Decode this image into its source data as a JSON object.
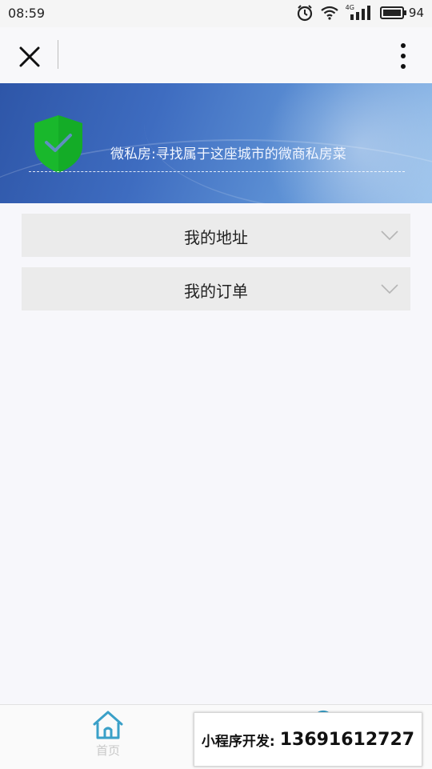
{
  "status_bar": {
    "time": "08:59",
    "network_type": "4G",
    "battery_level": "94",
    "icons": [
      "alarm-icon",
      "wifi-icon",
      "signal-icon",
      "battery-icon"
    ]
  },
  "nav_bar": {
    "close_icon": "close-icon",
    "more_icon": "more-vertical-icon"
  },
  "banner": {
    "slogan": "微私房:寻找属于这座城市的微商私房菜",
    "logo_icon": "shield-check-icon",
    "logo_color": "#19b82c"
  },
  "menu": {
    "items": [
      {
        "label": "我的地址",
        "icon": "chevron-down-icon"
      },
      {
        "label": "我的订单",
        "icon": "chevron-down-icon"
      }
    ]
  },
  "tab_bar": {
    "tabs": [
      {
        "label": "首页",
        "icon": "home-icon",
        "color": "#3aa0c8"
      }
    ]
  },
  "promo_overlay": {
    "label": "小程序开发:",
    "phone": "13691612727"
  }
}
